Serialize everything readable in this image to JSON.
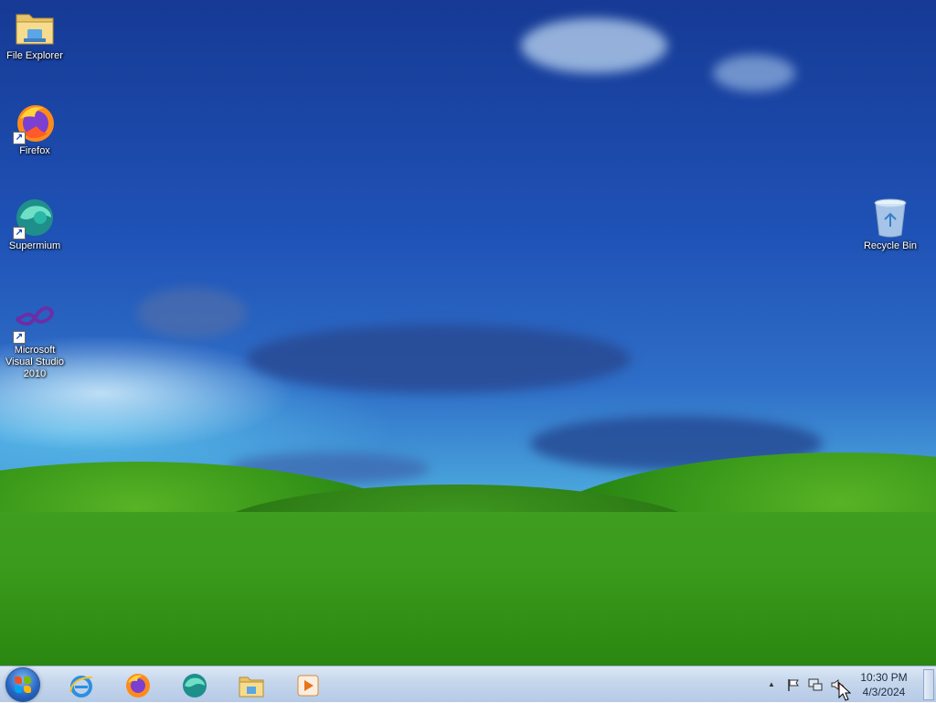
{
  "desktop": {
    "icons": [
      {
        "label": "File Explorer",
        "icon": "folder-icon",
        "shortcut": false
      },
      {
        "label": "Firefox",
        "icon": "firefox-icon",
        "shortcut": true
      },
      {
        "label": "Supermium",
        "icon": "supermium-icon",
        "shortcut": true
      },
      {
        "label": "Microsoft Visual Studio 2010",
        "icon": "visual-studio-icon",
        "shortcut": true
      },
      {
        "label": "Recycle Bin",
        "icon": "recycle-bin-icon",
        "shortcut": false
      }
    ],
    "shortcut_glyph": "↗"
  },
  "taskbar": {
    "start_icon": "windows-start-icon",
    "pinned": [
      {
        "name": "internet-explorer-icon"
      },
      {
        "name": "firefox-icon"
      },
      {
        "name": "supermium-icon"
      },
      {
        "name": "file-explorer-icon"
      },
      {
        "name": "media-player-icon"
      }
    ],
    "tray": {
      "show_hidden_glyph": "▲",
      "action_center_icon": "flag-icon",
      "network_icon": "network-icon",
      "volume_icon": "volume-muted-icon",
      "time": "10:30 PM",
      "date": "4/3/2024"
    }
  },
  "colors": {
    "taskbar": "#c5d6ec",
    "sky": "#1f52b6",
    "grass": "#3a9b1c"
  }
}
